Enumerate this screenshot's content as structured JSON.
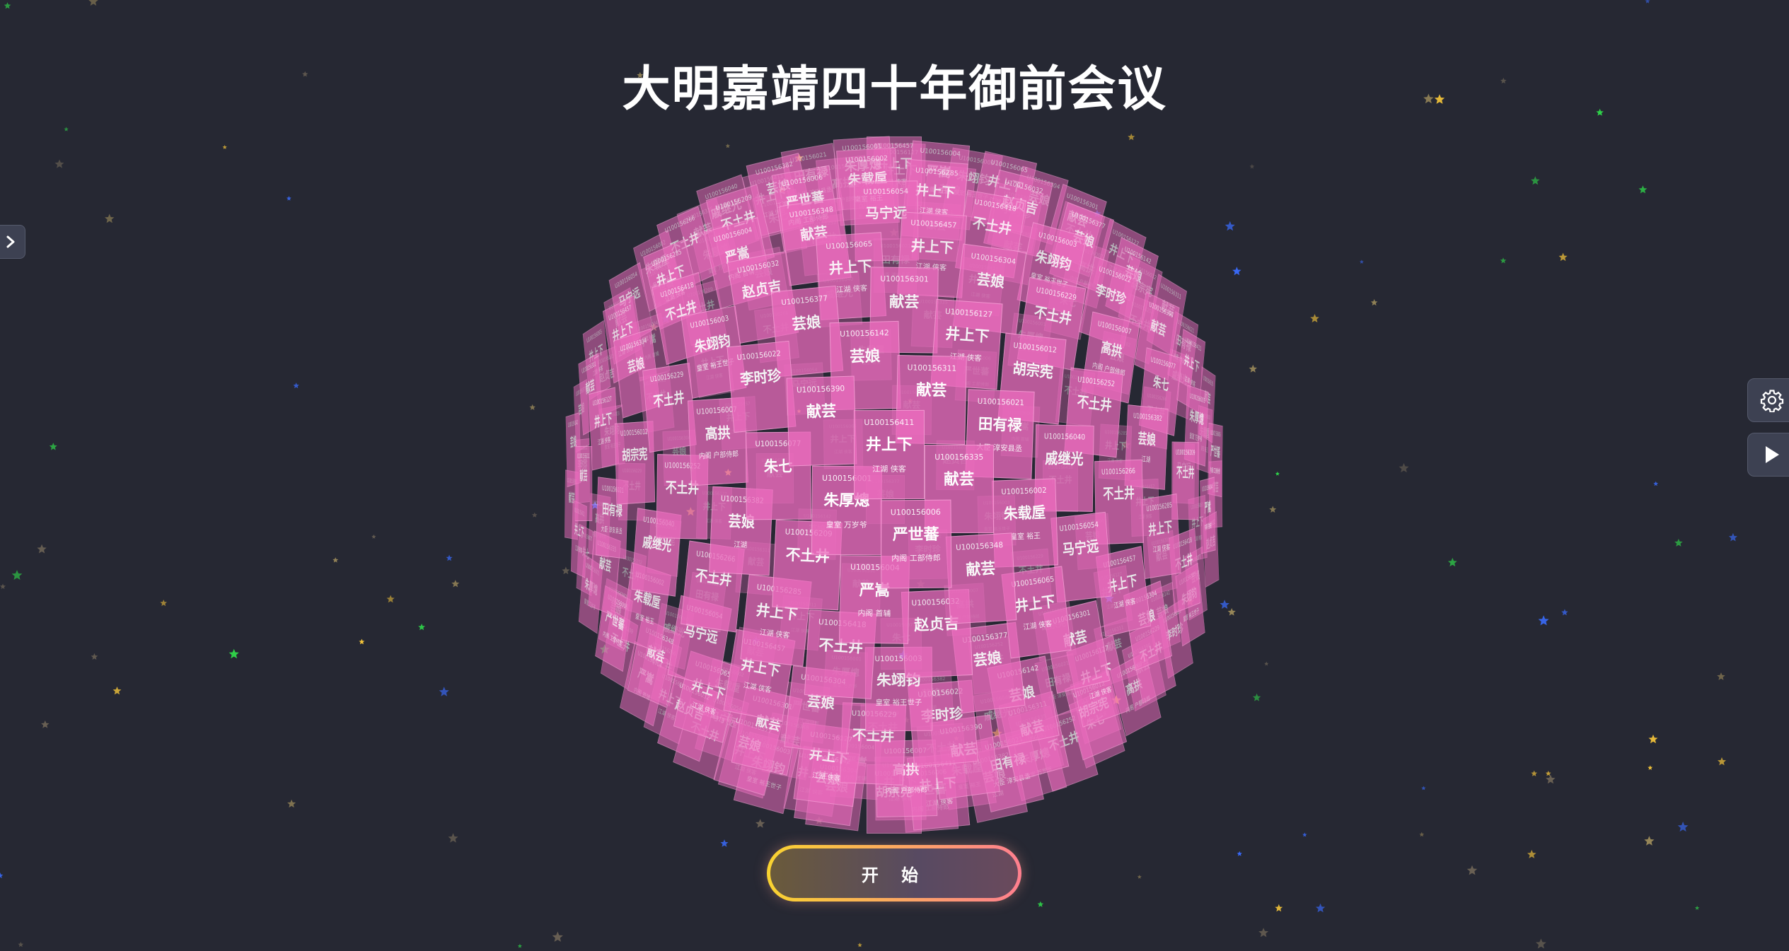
{
  "page": {
    "title": "大明嘉靖四十年御前会议",
    "start_button_label": "开 始"
  },
  "colors": {
    "background": "#262833",
    "card": "#ec6cbe",
    "button_gradient_start": "#f9d330",
    "button_gradient_end": "#ff7f8f"
  },
  "icons": {
    "sidebar_toggle": "chevron-right-icon",
    "settings": "gear-icon",
    "play": "play-icon"
  },
  "cards": [
    {
      "id": "U100156457",
      "name": "井上下",
      "info": "江湖 侠客"
    },
    {
      "id": "U100156001",
      "name": "朱厚熜",
      "info": "皇室 万岁爷"
    },
    {
      "id": "U100156127",
      "name": "井上下",
      "info": "江湖 侠客"
    },
    {
      "id": "U100156004",
      "name": "严嵩",
      "info": "内阁 首辅"
    },
    {
      "id": "U100156021",
      "name": "田有禄",
      "info": "大臣 淳安县丞"
    },
    {
      "id": "U100156003",
      "name": "朱翊钧",
      "info": "皇室 裕王世子"
    },
    {
      "id": "U100156002",
      "name": "朱载垕",
      "info": "皇室 裕王"
    },
    {
      "id": "U100156007",
      "name": "高拱",
      "info": "内阁 户部侍郎"
    },
    {
      "id": "U100156065",
      "name": "井上下",
      "info": "江湖 侠客"
    },
    {
      "id": "U100156382",
      "name": "芸娘",
      "info": "江湖"
    },
    {
      "id": "U100156142",
      "name": "芸娘",
      "info": ""
    },
    {
      "id": "U100156285",
      "name": "井上下",
      "info": "江湖 侠客"
    },
    {
      "id": "U100156411",
      "name": "井上下",
      "info": "江湖 侠客"
    },
    {
      "id": "U100156304",
      "name": "芸娘",
      "info": ""
    },
    {
      "id": "U100156006",
      "name": "严世蕃",
      "info": "内阁 工部侍郎"
    },
    {
      "id": "U100156012",
      "name": "胡宗宪",
      "info": ""
    },
    {
      "id": "U100156032",
      "name": "赵贞吉",
      "info": ""
    },
    {
      "id": "U100156040",
      "name": "戚继光",
      "info": ""
    },
    {
      "id": "U100156022",
      "name": "李时珍",
      "info": ""
    },
    {
      "id": "U100156054",
      "name": "马宁远",
      "info": ""
    },
    {
      "id": "U100156077",
      "name": "朱七",
      "info": ""
    },
    {
      "id": "U100156301",
      "name": "献芸",
      "info": ""
    },
    {
      "id": "U100156209",
      "name": "不土井",
      "info": ""
    },
    {
      "id": "U100156311",
      "name": "献芸",
      "info": ""
    },
    {
      "id": "U100156418",
      "name": "不土井",
      "info": ""
    },
    {
      "id": "U100156335",
      "name": "献芸",
      "info": ""
    },
    {
      "id": "U100156229",
      "name": "不土井",
      "info": ""
    },
    {
      "id": "U100156348",
      "name": "献芸",
      "info": ""
    },
    {
      "id": "U100156252",
      "name": "不土井",
      "info": ""
    },
    {
      "id": "U100156377",
      "name": "芸娘",
      "info": ""
    },
    {
      "id": "U100156266",
      "name": "不土井",
      "info": ""
    },
    {
      "id": "U100156390",
      "name": "献芸",
      "info": ""
    }
  ]
}
